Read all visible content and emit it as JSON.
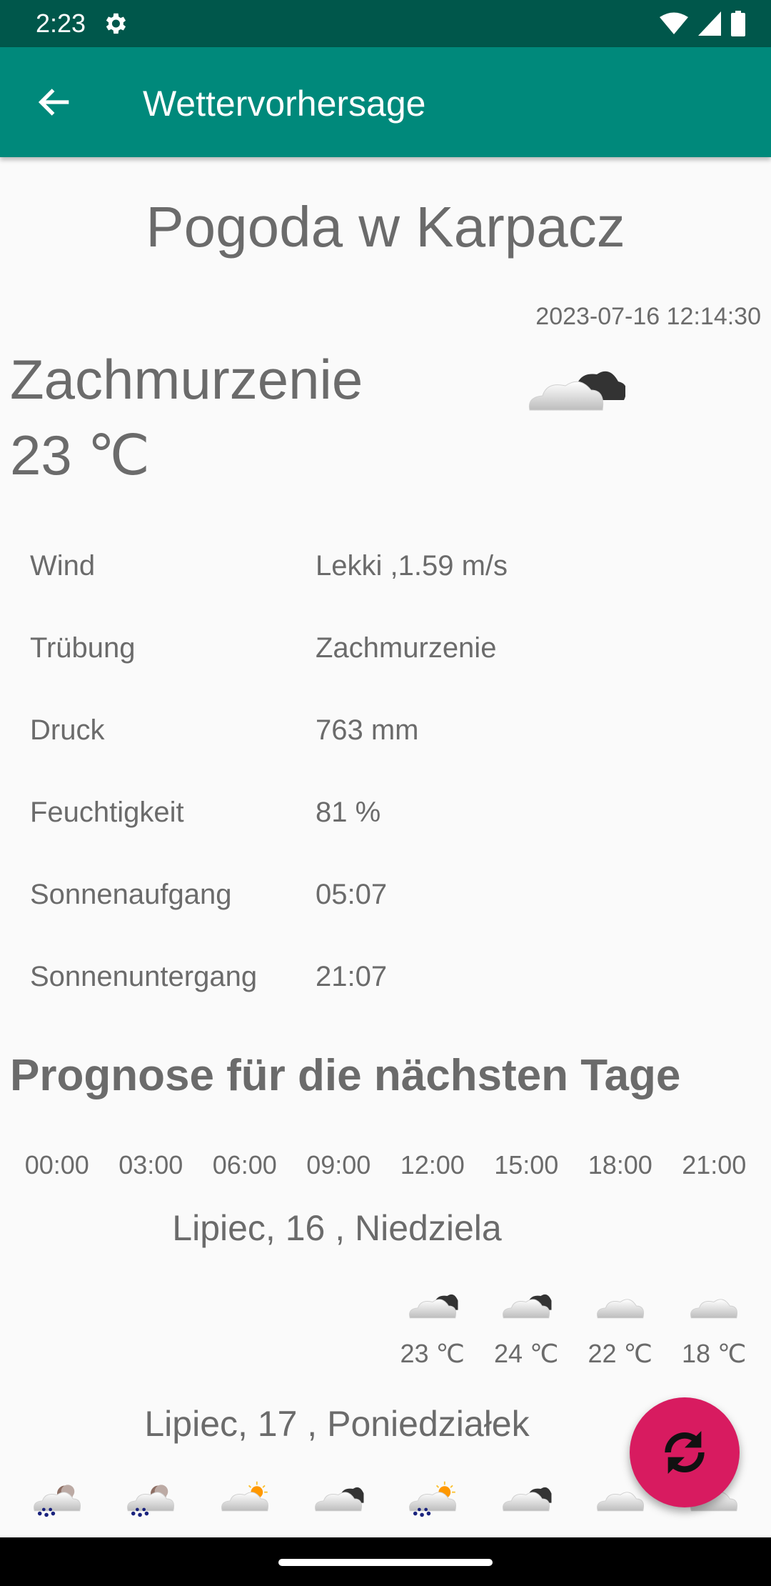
{
  "status_bar": {
    "time": "2:23"
  },
  "app_bar": {
    "title": "Wettervorhersage"
  },
  "current": {
    "city_title": "Pogoda w Karpacz",
    "datetime": "2023-07-16 12:14:30",
    "condition": "Zachmurzenie",
    "temperature": "23 ℃",
    "icon": "cloud-dark-icon"
  },
  "details": [
    {
      "label": "Wind",
      "value": "Lekki ,1.59 m/s"
    },
    {
      "label": "Trübung",
      "value": "Zachmurzenie"
    },
    {
      "label": "Druck",
      "value": "763 mm"
    },
    {
      "label": "Feuchtigkeit",
      "value": "81 %"
    },
    {
      "label": "Sonnenaufgang",
      "value": "05:07"
    },
    {
      "label": "Sonnenuntergang",
      "value": "21:07"
    }
  ],
  "forecast": {
    "title": "Prognose für die nächsten Tage",
    "hours": [
      "00:00",
      "03:00",
      "06:00",
      "09:00",
      "12:00",
      "15:00",
      "18:00",
      "21:00"
    ],
    "days": [
      {
        "name": "Lipiec, 16 , Niedziela",
        "slots": [
          {
            "icon": null,
            "temp": ""
          },
          {
            "icon": null,
            "temp": ""
          },
          {
            "icon": null,
            "temp": ""
          },
          {
            "icon": null,
            "temp": ""
          },
          {
            "icon": "cloud-dark-icon",
            "temp": "23 ℃"
          },
          {
            "icon": "cloud-dark-icon",
            "temp": "24 ℃"
          },
          {
            "icon": "cloud-icon",
            "temp": "22 ℃"
          },
          {
            "icon": "cloud-icon",
            "temp": "18 ℃"
          }
        ]
      },
      {
        "name": "Lipiec, 17 , Poniedziałek",
        "slots": [
          {
            "icon": "rain-night-icon",
            "temp": ""
          },
          {
            "icon": "rain-night-icon",
            "temp": ""
          },
          {
            "icon": "cloud-sun-icon",
            "temp": ""
          },
          {
            "icon": "cloud-dark-icon",
            "temp": ""
          },
          {
            "icon": "rain-sun-icon",
            "temp": ""
          },
          {
            "icon": "cloud-dark-icon",
            "temp": ""
          },
          {
            "icon": "cloud-icon",
            "temp": ""
          },
          {
            "icon": "cloud-icon",
            "temp": ""
          }
        ]
      }
    ]
  },
  "fab": {
    "icon": "refresh-icon"
  },
  "colors": {
    "status_bar": "#00574b",
    "app_bar": "#00897b",
    "fab": "#d81b60",
    "text": "#6b6b6b"
  }
}
